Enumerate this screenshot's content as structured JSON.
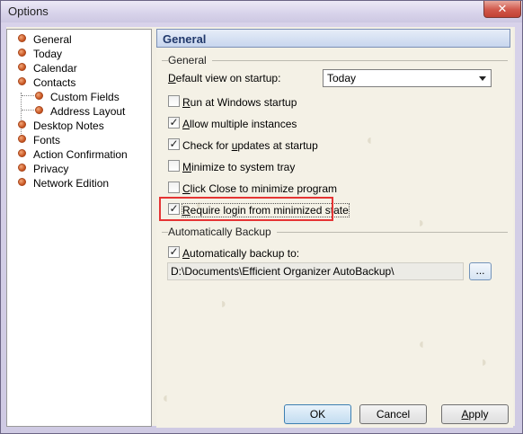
{
  "window": {
    "title": "Options",
    "close_label": "✕"
  },
  "tree": {
    "items": [
      {
        "label": "General",
        "level": 0
      },
      {
        "label": "Today",
        "level": 0
      },
      {
        "label": "Calendar",
        "level": 0
      },
      {
        "label": "Contacts",
        "level": 0
      },
      {
        "label": "Custom Fields",
        "level": 1
      },
      {
        "label": "Address Layout",
        "level": 1
      },
      {
        "label": "Desktop Notes",
        "level": 0
      },
      {
        "label": "Fonts",
        "level": 0
      },
      {
        "label": "Action Confirmation",
        "level": 0
      },
      {
        "label": "Privacy",
        "level": 0
      },
      {
        "label": "Network Edition",
        "level": 0
      }
    ]
  },
  "panel": {
    "header": "General",
    "general_group": "General",
    "default_view": {
      "label_prefix": "D",
      "label_rest": "efault view on startup:",
      "value": "Today"
    },
    "checkboxes": [
      {
        "u": "R",
        "rest": "un at Windows startup",
        "checked": false
      },
      {
        "u": "A",
        "rest": "llow multiple instances",
        "checked": true
      },
      {
        "pre": "Check for ",
        "u": "u",
        "rest": "pdates at startup",
        "checked": true
      },
      {
        "u": "M",
        "rest": "inimize to system tray",
        "checked": false
      },
      {
        "u": "C",
        "rest": "lick Close to minimize program",
        "checked": false
      },
      {
        "u": "R",
        "rest": "equire login from minimized state",
        "checked": true
      }
    ],
    "backup_group": "Automatically Backup",
    "auto_backup": {
      "u": "A",
      "rest": "utomatically backup to:",
      "checked": true
    },
    "backup_path": "D:\\Documents\\Efficient Organizer AutoBackup\\",
    "browse_label": "..."
  },
  "buttons": {
    "ok": "OK",
    "cancel": "Cancel",
    "apply_u": "A",
    "apply_rest": "pply"
  }
}
